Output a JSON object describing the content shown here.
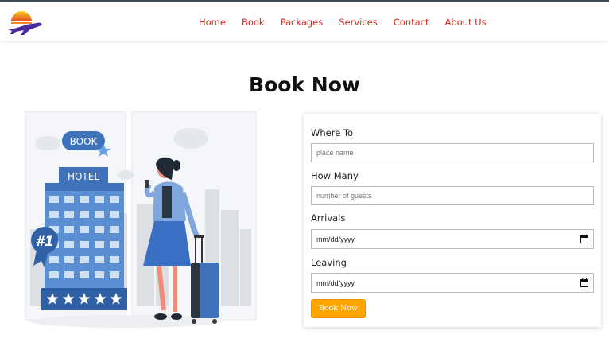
{
  "nav": {
    "items": [
      {
        "label": "Home"
      },
      {
        "label": "Book"
      },
      {
        "label": "Packages"
      },
      {
        "label": "Services"
      },
      {
        "label": "Contact"
      },
      {
        "label": "About Us"
      }
    ]
  },
  "page": {
    "title": "Book Now"
  },
  "illustration": {
    "book_sign": "BOOK",
    "hotel_sign": "HOTEL",
    "badge": "#1",
    "stars": 5
  },
  "form": {
    "where_label": "Where To",
    "where_placeholder": "place name",
    "howmany_label": "How Many",
    "howmany_placeholder": "number of guests",
    "arrivals_label": "Arrivals",
    "arrivals_value": "mm/dd/yyyy",
    "leaving_label": "Leaving",
    "leaving_value": "mm/dd/yyyy",
    "submit_label": "Book Now"
  },
  "colors": {
    "nav_link": "#d7261e",
    "button": "#ffa500",
    "hotel_blue": "#3f72b8",
    "logo_plane": "#4b2aa0",
    "logo_sun": "#f7a81b"
  }
}
